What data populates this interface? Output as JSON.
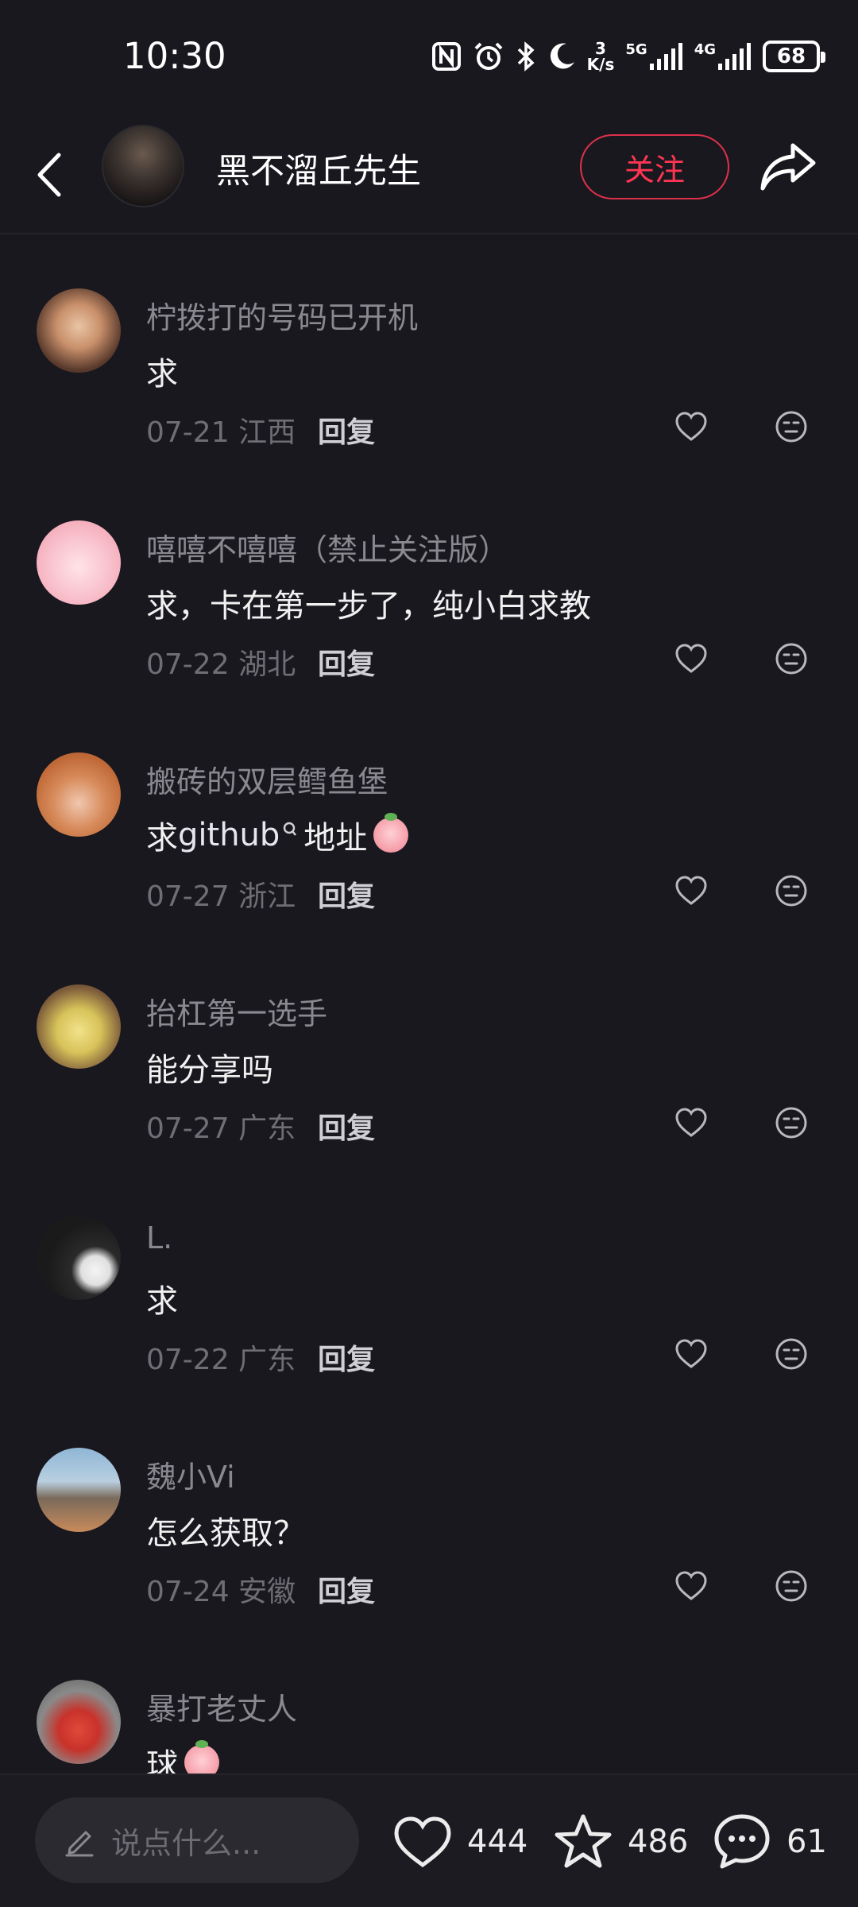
{
  "status_bar": {
    "time": "10:30",
    "speed_value": "3",
    "speed_unit": "K/s",
    "net1": "5G",
    "net2": "4G",
    "battery": "68",
    "icons": [
      "nfc-icon",
      "alarm-icon",
      "bluetooth-icon",
      "moon-icon",
      "signal-icon",
      "battery-icon"
    ]
  },
  "header": {
    "name": "黑不溜丘先生",
    "follow_label": "关注",
    "icons": [
      "back-icon",
      "share-icon"
    ]
  },
  "comments": [
    {
      "user": "柠拨打的号码已开机",
      "text": "求",
      "date": "07-21",
      "region": "江西",
      "reply": "回复"
    },
    {
      "user": "嘻嘻不嘻嘻（禁止关注版）",
      "text": "求，卡在第一步了，纯小白求教",
      "date": "07-22",
      "region": "湖北",
      "reply": "回复"
    },
    {
      "user": "搬砖的双层鳕鱼堡",
      "text_prefix": "求 ",
      "text_link": "github",
      "text_suffix": " 地址",
      "date": "07-27",
      "region": "浙江",
      "reply": "回复"
    },
    {
      "user": "抬杠第一选手",
      "text": "能分享吗",
      "date": "07-27",
      "region": "广东",
      "reply": "回复"
    },
    {
      "user": "L.",
      "text": "求",
      "date": "07-22",
      "region": "广东",
      "reply": "回复"
    },
    {
      "user": "魏小Vi",
      "text": "怎么获取？",
      "date": "07-24",
      "region": "安徽",
      "reply": "回复"
    },
    {
      "user": "暴打老丈人",
      "text": "球",
      "date": "",
      "region": "",
      "reply": ""
    }
  ],
  "bottom_bar": {
    "input_placeholder": "说点什么...",
    "likes": "444",
    "favorites": "486",
    "comments": "61"
  },
  "colors": {
    "background": "#19181f",
    "accent": "#ff3553",
    "muted": "#8a8990"
  }
}
